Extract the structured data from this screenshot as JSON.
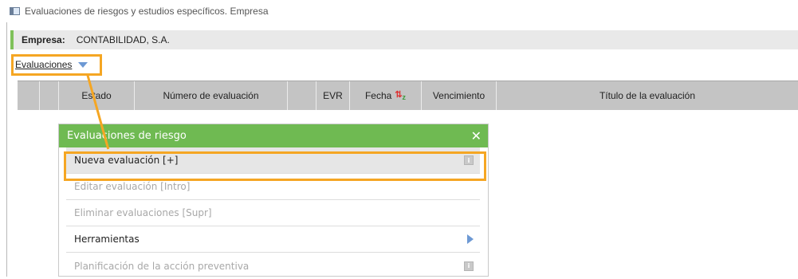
{
  "window": {
    "title": "Evaluaciones de riesgos y estudios específicos. Empresa"
  },
  "company": {
    "label": "Empresa:",
    "value": "CONTABILIDAD, S.A."
  },
  "menu": {
    "evaluaciones": "Evaluaciones"
  },
  "grid": {
    "columns": [
      "Estado",
      "Número de evaluación",
      "EVR",
      "Fecha",
      "Vencimiento",
      "Título de la evaluación"
    ]
  },
  "popup": {
    "title": "Evaluaciones de riesgo",
    "items": [
      {
        "label": "Nueva evaluación  [+]",
        "state": "enabled",
        "trailing_icon": "info-icon"
      },
      {
        "label": "Editar evaluación  [Intro]",
        "state": "disabled"
      },
      {
        "label": "Eliminar evaluaciones  [Supr]",
        "state": "disabled"
      },
      {
        "label": "Herramientas",
        "state": "enabled",
        "trailing_icon": "chevron-right-icon"
      },
      {
        "label": "Planificación de la acción preventiva",
        "state": "disabled",
        "trailing_icon": "info-icon"
      }
    ]
  },
  "colors": {
    "accent_green": "#6fba52",
    "highlight_orange": "#f5a623",
    "arrow_blue": "#6d99d4",
    "header_gray": "#c4c4c4"
  }
}
